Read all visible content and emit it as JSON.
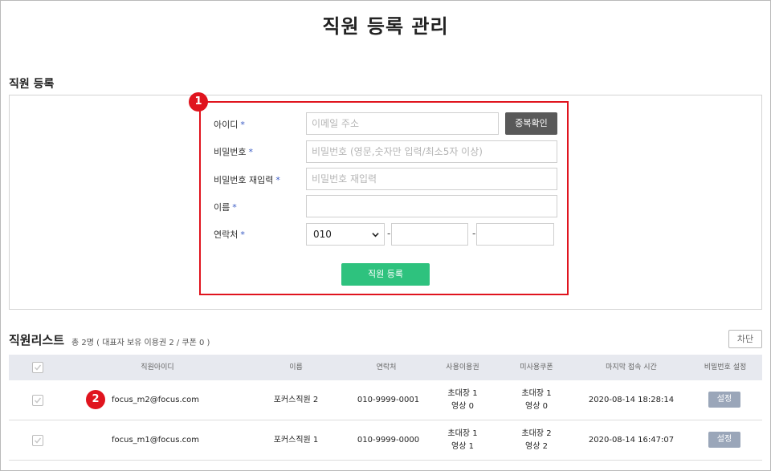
{
  "page_title": "직원 등록 관리",
  "registration": {
    "section_title": "직원 등록",
    "marker": "1",
    "fields": {
      "id_label": "아이디",
      "id_placeholder": "이메일 주소",
      "dup_check": "중복확인",
      "password_label": "비밀번호",
      "password_placeholder": "비밀번호 (영문,숫자만 입력/최소5자 이상)",
      "password_confirm_label": "비밀번호 재입력",
      "password_confirm_placeholder": "비밀번호 재입력",
      "name_label": "이름",
      "name_value": "",
      "phone_label": "연락처",
      "phone_prefix": "010",
      "phone_sep": "-",
      "phone_mid": "",
      "phone_last": ""
    },
    "required_mark": "*",
    "submit": "직원 등록"
  },
  "list": {
    "title": "직원리스트",
    "summary": "총 2명 ( 대표자 보유 이용권 2 / 쿠폰 0 )",
    "block_button": "차단",
    "marker": "2",
    "columns": [
      "직원아이디",
      "이름",
      "연락처",
      "사용이용권",
      "미사용쿠폰",
      "마지막 접속 시간",
      "비밀번호 설정"
    ],
    "rows": [
      {
        "id": "focus_m2@focus.com",
        "name": "포커스직원 2",
        "phone": "010-9999-0001",
        "used_1": "초대장 1",
        "used_2": "영상 0",
        "unused_1": "초대장 1",
        "unused_2": "영상 0",
        "last_login": "2020-08-14 18:28:14",
        "action": "설정"
      },
      {
        "id": "focus_m1@focus.com",
        "name": "포커스직원 1",
        "phone": "010-9999-0000",
        "used_1": "초대장 1",
        "used_2": "영상 1",
        "unused_1": "초대장 2",
        "unused_2": "영상 2",
        "last_login": "2020-08-14 16:47:07",
        "action": "설정"
      }
    ]
  },
  "colors": {
    "highlight": "#e0141e",
    "submit": "#2ec27e",
    "required": "#3b5cc4",
    "settings_button": "#9aa6b9"
  }
}
